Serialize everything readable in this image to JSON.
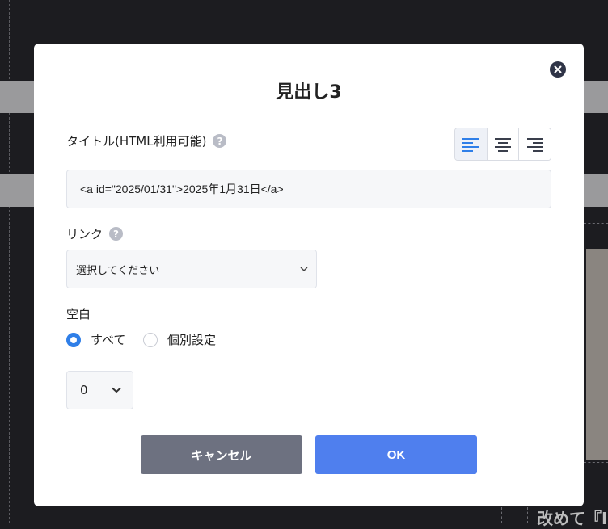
{
  "background": {
    "partial_text": "改めて『I"
  },
  "modal": {
    "title": "見出し3",
    "close_icon": "close-icon",
    "title_field": {
      "label": "タイトル(HTML利用可能)",
      "help": "?",
      "value": "<a id=\"2025/01/31\">2025年1月31日</a>",
      "alignment": {
        "options": [
          "align-left-icon",
          "align-center-icon",
          "align-right-icon"
        ],
        "selected": "left"
      }
    },
    "link": {
      "label": "リンク",
      "help": "?",
      "selected": "選択してください"
    },
    "spacing": {
      "label": "空白",
      "radio_all": "すべて",
      "radio_individual": "個別設定",
      "selected_radio": "すべて",
      "value": "0"
    },
    "buttons": {
      "cancel": "キャンセル",
      "ok": "OK"
    }
  },
  "colors": {
    "accent": "#2f7fe8",
    "ok_button": "#4f7fee",
    "cancel_button": "#6d7180",
    "overlay": "#1c1c20"
  }
}
